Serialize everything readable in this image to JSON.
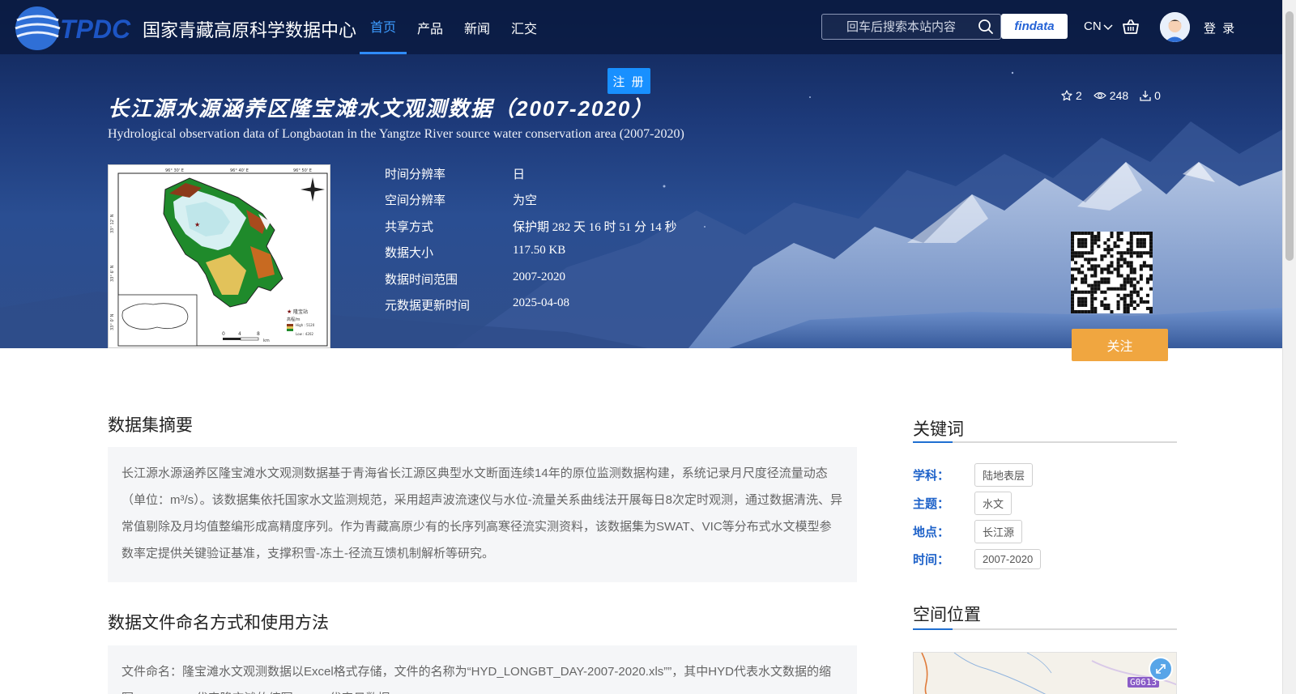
{
  "header": {
    "logo_text": "TPDC",
    "logo_cn": "国家青藏高原科学数据中心",
    "nav": [
      {
        "label": "首页",
        "active": true
      },
      {
        "label": "产品",
        "active": false
      },
      {
        "label": "新闻",
        "active": false
      },
      {
        "label": "汇交",
        "active": false
      }
    ],
    "search_placeholder": "回车后搜索本站内容",
    "findata_label": "findata",
    "lang_label": "CN",
    "login_label": "登 录",
    "register_label": "注 册"
  },
  "dataset": {
    "title_cn": "长江源水源涵养区隆宝滩水文观测数据（2007-2020）",
    "title_en": "Hydrological observation data of Longbaotan in the Yangtze River source water conservation area (2007-2020)",
    "stats": {
      "stars": "2",
      "views": "248",
      "downloads": "0"
    },
    "meta": [
      {
        "label": "时间分辨率",
        "value": "日"
      },
      {
        "label": "空间分辨率",
        "value": "为空"
      },
      {
        "label": "共享方式",
        "value": "保护期 282 天 16 时 51 分 14 秒"
      },
      {
        "label": "数据大小",
        "value": "117.50 KB"
      },
      {
        "label": "数据时间范围",
        "value": "2007-2020"
      },
      {
        "label": "元数据更新时间",
        "value": "2025-04-08"
      }
    ],
    "follow_label": "关注"
  },
  "thumbnail": {
    "lon_ticks": [
      "96° 30' E",
      "96° 40' E",
      "96° 50' E"
    ],
    "lat_ticks": [
      "33° 12' N",
      "33° 6' N",
      "33° 0' N"
    ],
    "legend_station": "隆宝站",
    "legend_elev": "高程/m",
    "legend_high": "High : 5120",
    "legend_low": "Low : 4202",
    "scale": [
      "0",
      "4",
      "8"
    ],
    "scale_unit": "km"
  },
  "abstract": {
    "title": "数据集摘要",
    "text": "长江源水源涵养区隆宝滩水文观测数据基于青海省长江源区典型水文断面连续14年的原位监测数据构建，系统记录月尺度径流量动态（单位：m³/s）。该数据集依托国家水文监测规范，采用超声波流速仪与水位-流量关系曲线法开展每日8次定时观测，通过数据清洗、异常值剔除及月均值整编形成高精度序列。作为青藏高原少有的长序列高寒径流实测资料，该数据集为SWAT、VIC等分布式水文模型参数率定提供关键验证基准，支撑积雪-冻土-径流互馈机制解析等研究。"
  },
  "naming": {
    "title": "数据文件命名方式和使用方法",
    "text": "文件命名：隆宝滩水文观测数据以Excel格式存储，文件的名称为“HYD_LONGBT_DAY-2007-2020.xls””，其中HYD代表水文数据的缩写，LONGBT代表隆宝滩的缩写，DAY代表日数据。"
  },
  "keywords": {
    "title": "关键词",
    "rows": [
      {
        "label": "学科：",
        "tag": "陆地表层"
      },
      {
        "label": "主题：",
        "tag": "水文"
      },
      {
        "label": "地点：",
        "tag": "长江源"
      },
      {
        "label": "时间：",
        "tag": "2007-2020"
      }
    ]
  },
  "location": {
    "title": "空间位置",
    "road_badge": "G0613"
  }
}
